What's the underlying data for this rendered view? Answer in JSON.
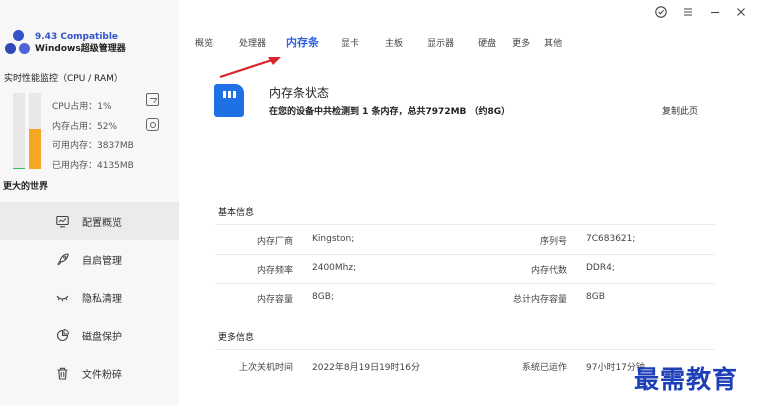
{
  "app": {
    "version": "9.43 Compatible",
    "name": "Windows超级管理器"
  },
  "monitor": {
    "title": "实时性能监控（CPU / RAM）",
    "cpu_usage": "CPU占用：1%",
    "mem_usage": "内存占用：52%",
    "mem_available": "可用内存：3837MB",
    "mem_used": "已用内存：4135MB",
    "cpu_percent": 1,
    "mem_percent": 52,
    "tagline": "更大的世界"
  },
  "sidebar": {
    "items": [
      {
        "label": "配置概览",
        "icon": "monitor-icon"
      },
      {
        "label": "自启管理",
        "icon": "rocket-icon"
      },
      {
        "label": "隐私清理",
        "icon": "eye-closed-icon"
      },
      {
        "label": "磁盘保护",
        "icon": "pie-chart-icon"
      },
      {
        "label": "文件粉碎",
        "icon": "trash-icon"
      }
    ]
  },
  "tabs": [
    "概览",
    "处理器",
    "内存条",
    "显卡",
    "主板",
    "显示器",
    "硬盘",
    "更多",
    "其他"
  ],
  "active_tab": "内存条",
  "status": {
    "title": "内存条状态",
    "subtitle": "在您的设备中共检测到 1 条内存，总共7972MB （约8G）",
    "copy_page": "复制此页"
  },
  "basic_info": {
    "title": "基本信息",
    "rows": [
      {
        "l1": "内存厂商",
        "v1": "Kingston;",
        "l2": "序列号",
        "v2": "7C683621;"
      },
      {
        "l1": "内存频率",
        "v1": "2400Mhz;",
        "l2": "内存代数",
        "v2": "DDR4;"
      },
      {
        "l1": "内存容量",
        "v1": "8GB;",
        "l2": "总计内存容量",
        "v2": "8GB"
      }
    ]
  },
  "more_info": {
    "title": "更多信息",
    "rows": [
      {
        "l1": "上次关机时间",
        "v1": "2022年8月19日19时16分",
        "l2": "系统已运作",
        "v2": "97小时17分钟"
      }
    ]
  },
  "watermark": "最需教育",
  "colors": {
    "accent": "#2f62e0",
    "ram_icon": "#1f6fe5",
    "arrow": "#d9262c",
    "mem_bar": "#f5a623",
    "cpu_bar": "#3bb56a"
  }
}
